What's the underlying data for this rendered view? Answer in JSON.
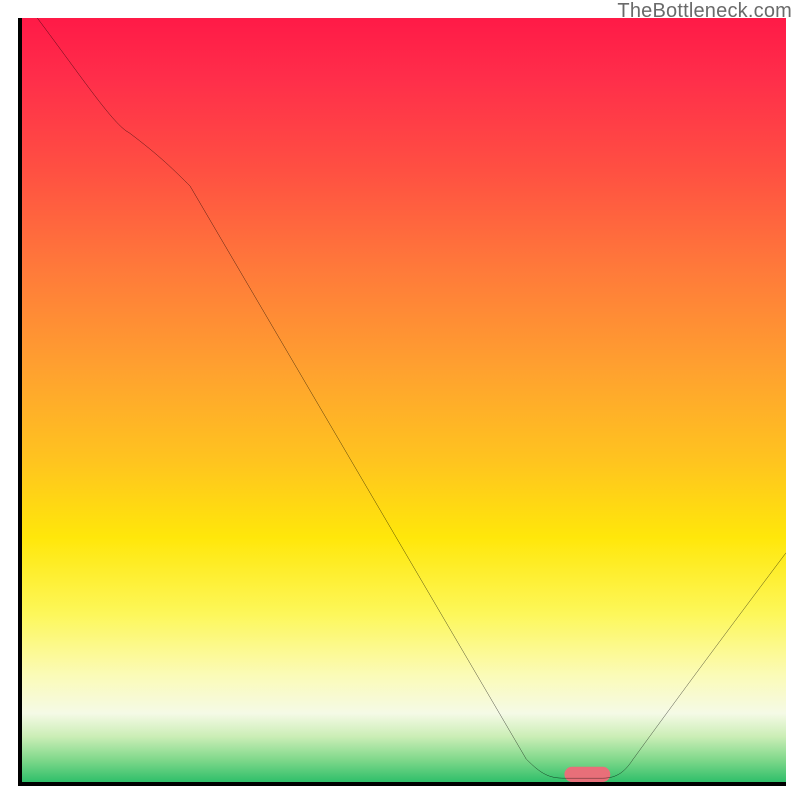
{
  "watermark": "TheBottleneck.com",
  "chart_data": {
    "type": "line",
    "title": "",
    "xlabel": "",
    "ylabel": "",
    "xlim": [
      0,
      100
    ],
    "ylim": [
      0,
      100
    ],
    "grid": false,
    "legend": false,
    "series": [
      {
        "name": "bottleneck-curve",
        "x": [
          2,
          14,
          22,
          66,
          71,
          76,
          80,
          100
        ],
        "y": [
          100,
          85,
          78,
          3,
          0.5,
          0.5,
          3,
          30
        ],
        "color": "#000000"
      }
    ],
    "marker": {
      "name": "optimal-point",
      "x_start": 71,
      "x_end": 76,
      "y": 1,
      "color": "#e86f79"
    },
    "background_gradient_stops": [
      {
        "pos": 0,
        "color": "#ff1a47"
      },
      {
        "pos": 8,
        "color": "#ff2e4a"
      },
      {
        "pos": 20,
        "color": "#ff5042"
      },
      {
        "pos": 33,
        "color": "#ff7a3a"
      },
      {
        "pos": 46,
        "color": "#ffa12f"
      },
      {
        "pos": 58,
        "color": "#ffc41f"
      },
      {
        "pos": 68,
        "color": "#ffe70a"
      },
      {
        "pos": 78,
        "color": "#fdf75a"
      },
      {
        "pos": 86,
        "color": "#fbfbb7"
      },
      {
        "pos": 91,
        "color": "#f5fae6"
      },
      {
        "pos": 94,
        "color": "#cceeb7"
      },
      {
        "pos": 97,
        "color": "#82d98c"
      },
      {
        "pos": 100,
        "color": "#2fbf6a"
      }
    ]
  }
}
